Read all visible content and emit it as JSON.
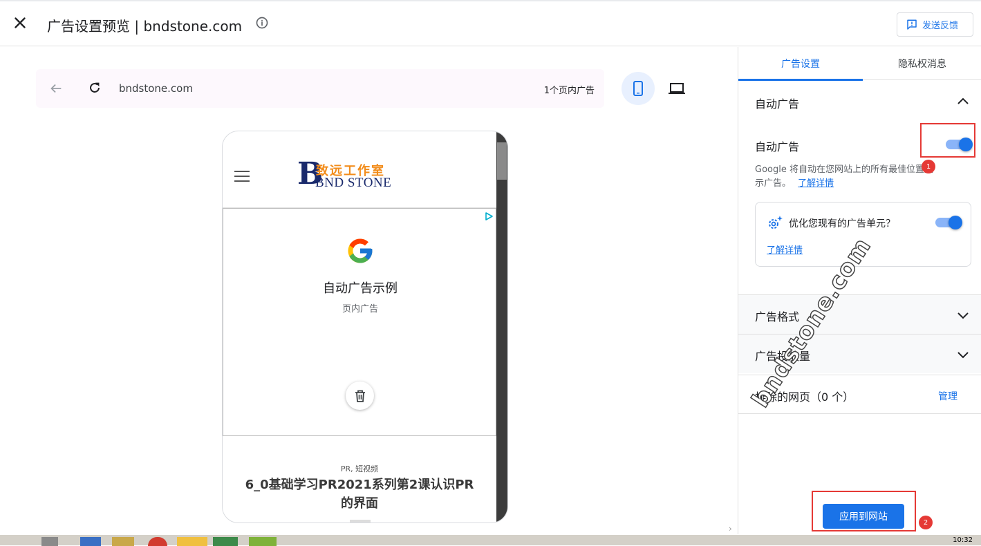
{
  "header": {
    "title": "广告设置预览 | bndstone.com",
    "feedback_label": "发送反馈"
  },
  "preview": {
    "url": "bndstone.com",
    "ad_count": "1个页内广告",
    "site": {
      "logo_letter": "B",
      "logo_cn": "致远工作室",
      "logo_en": "BND STONE"
    },
    "ad": {
      "title": "自动广告示例",
      "subtitle": "页内广告"
    },
    "article": {
      "category": "PR, 短视频",
      "title": "6_0基础学习PR2021系列第2课认识PR的界面"
    }
  },
  "sidebar": {
    "tabs": [
      {
        "label": "广告设置",
        "active": true
      },
      {
        "label": "隐私权消息",
        "active": false
      }
    ],
    "auto_ads": {
      "section_title": "自动广告",
      "toggle_label": "自动广告",
      "toggle_on": true,
      "description": "Google 将自动在您网站上的所有最佳位置展示广告。",
      "learn_more": "了解详情",
      "optimize": {
        "label": "优化您现有的广告单元？",
        "toggle_on": true,
        "learn_more": "了解详情"
      }
    },
    "ad_formats": {
      "title": "广告格式"
    },
    "ad_load": {
      "title": "广告投放量"
    },
    "excluded": {
      "title": "排除的网页（0 个）",
      "manage": "管理"
    },
    "apply_label": "应用到网站"
  },
  "annotations": {
    "badge1": "1",
    "badge2": "2"
  },
  "watermark": "bndstone.com",
  "taskbar": {
    "clock": "10:32"
  },
  "colors": {
    "accent": "#1a73e8",
    "annotation_red": "#e53935",
    "logo_navy": "#1a2a6c",
    "logo_orange": "#f28c1a"
  }
}
